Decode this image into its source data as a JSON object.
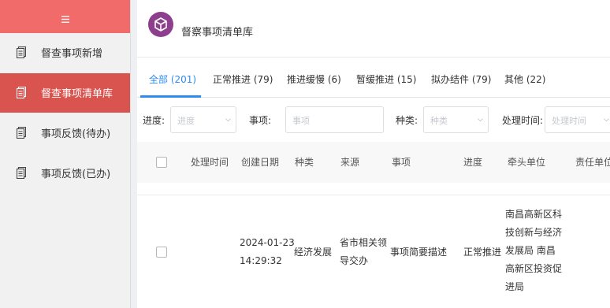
{
  "sidebar": {
    "toggle_icon": "hamburger-icon",
    "items": [
      {
        "label": "督查事项新增",
        "icon": "document-icon",
        "active": false
      },
      {
        "label": "督查事项清单库",
        "icon": "document-icon",
        "active": true
      },
      {
        "label": "事项反馈(待办)",
        "icon": "document-icon",
        "active": false
      },
      {
        "label": "事项反馈(已办)",
        "icon": "document-icon",
        "active": false
      }
    ]
  },
  "header": {
    "logo_icon": "cube-logo-icon",
    "title": "督察事项清单库"
  },
  "tabs": [
    {
      "label": "全部 (201)",
      "active": true
    },
    {
      "label": "正常推进 (79)",
      "active": false
    },
    {
      "label": "推进缓慢 (6)",
      "active": false
    },
    {
      "label": "暂缓推进 (15)",
      "active": false
    },
    {
      "label": "拟办结件 (79)",
      "active": false
    },
    {
      "label": "其他 (22)",
      "active": false
    }
  ],
  "filters": {
    "progress_label": "进度:",
    "progress_placeholder": "进度",
    "item_label": "事项:",
    "item_placeholder": "事项",
    "category_label": "种类:",
    "category_placeholder": "种类",
    "time_label": "处理时间:",
    "time_placeholder": "处理时间"
  },
  "table": {
    "columns": [
      "处理时间",
      "创建日期",
      "种类",
      "来源",
      "事项",
      "进度",
      "牵头单位",
      "责任单位"
    ],
    "rows": [
      {
        "processing_time": "",
        "created_date": "2024-01-23",
        "created_time": "14:29:32",
        "category": "经济发展",
        "source_line1": "省市相关领",
        "source_line2": "导交办",
        "item": "事项简要描述",
        "progress": "正常推进",
        "lead_unit_lines": [
          "南昌高新区科",
          "技创新与经济",
          "发展局 南昌",
          "高新区投资促",
          "进局"
        ]
      }
    ]
  },
  "colors": {
    "sidebar_top": "#f26b6b",
    "sidebar_active": "#d9534f",
    "accent_blue": "#2d8cf0",
    "logo_purple": "#8d3f8e"
  }
}
